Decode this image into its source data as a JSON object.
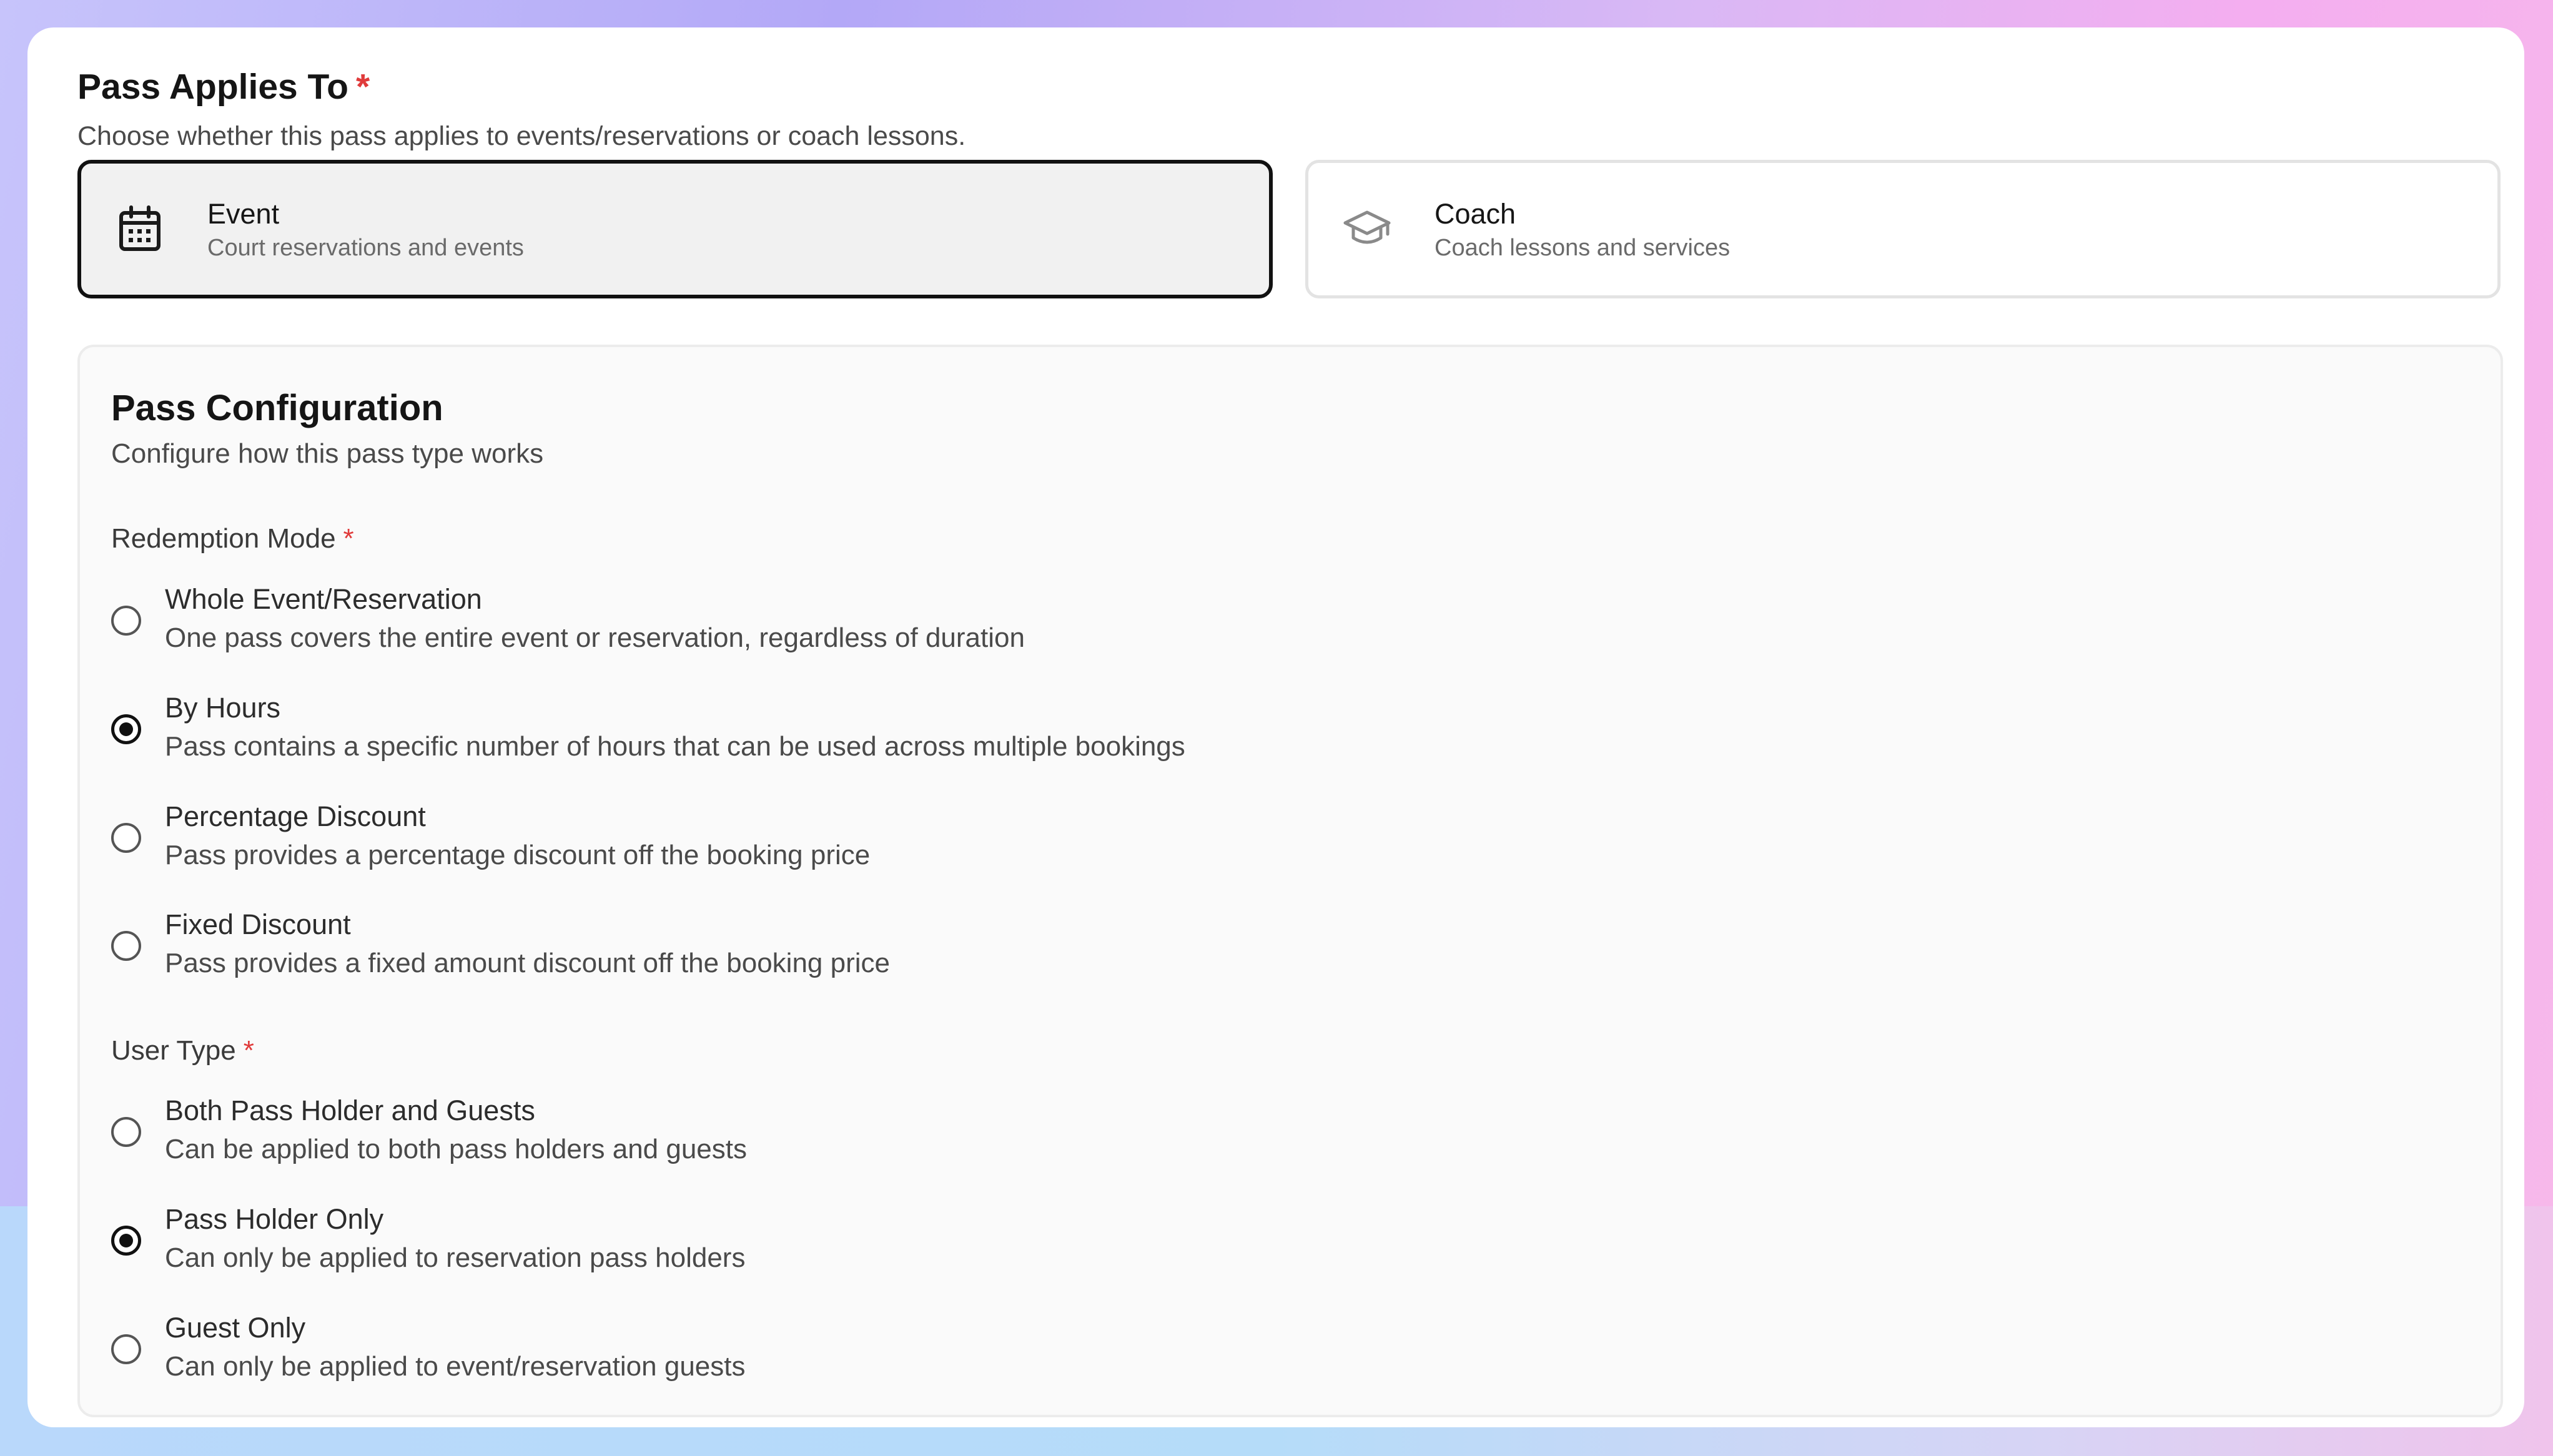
{
  "section": {
    "title": "Pass Applies To",
    "required_mark": "*",
    "subtitle": "Choose whether this pass applies to events/reservations or coach lessons."
  },
  "applies_options": [
    {
      "title": "Event",
      "description": "Court reservations and events",
      "icon": "calendar-icon",
      "selected": true
    },
    {
      "title": "Coach",
      "description": "Coach lessons and services",
      "icon": "graduation-cap-icon",
      "selected": false
    }
  ],
  "config": {
    "title": "Pass Configuration",
    "subtitle": "Configure how this pass type works",
    "redemption": {
      "label": "Redemption Mode",
      "required_mark": "*",
      "options": [
        {
          "title": "Whole Event/Reservation",
          "description": "One pass covers the entire event or reservation, regardless of duration",
          "selected": false
        },
        {
          "title": "By Hours",
          "description": "Pass contains a specific number of hours that can be used across multiple bookings",
          "selected": true
        },
        {
          "title": "Percentage Discount",
          "description": "Pass provides a percentage discount off the booking price",
          "selected": false
        },
        {
          "title": "Fixed Discount",
          "description": "Pass provides a fixed amount discount off the booking price",
          "selected": false
        }
      ]
    },
    "user_type": {
      "label": "User Type",
      "required_mark": "*",
      "options": [
        {
          "title": "Both Pass Holder and Guests",
          "description": "Can be applied to both pass holders and guests",
          "selected": false
        },
        {
          "title": "Pass Holder Only",
          "description": "Can only be applied to reservation pass holders",
          "selected": true
        },
        {
          "title": "Guest Only",
          "description": "Can only be applied to event/reservation guests",
          "selected": false
        }
      ]
    }
  },
  "colors": {
    "required": "#e03b3b",
    "selected_border": "#111111",
    "text": "#151515"
  }
}
